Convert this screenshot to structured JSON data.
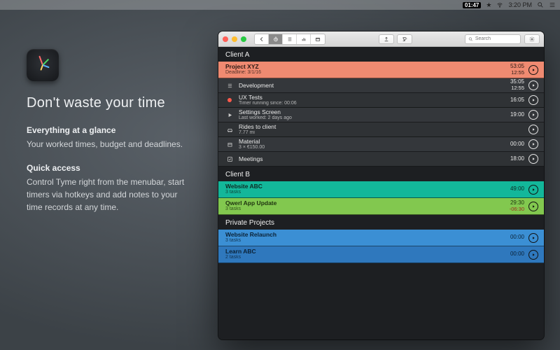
{
  "menubar": {
    "date_badge": "01:47",
    "time": "3:20 PM",
    "wifi_icon": "wifi",
    "list_icon": "list"
  },
  "marketing": {
    "headline": "Don't waste your time",
    "sec1_title": "Everything at a glance",
    "sec1_body": "Your worked times, budget and deadlines.",
    "sec2_title": "Quick access",
    "sec2_body": "Control Tyme right from the menubar, start timers via hotkeys and add notes to your time records at any time."
  },
  "toolbar": {
    "search_placeholder": "Search"
  },
  "groups": [
    {
      "name": "Client A",
      "projects": [
        {
          "color": "salmon",
          "title": "Project XYZ",
          "subtitle": "Deadline: 3/1/16",
          "time_top": "53:05",
          "time_bottom": "12:55",
          "tasks": [
            {
              "icon": "list",
              "title": "Development",
              "sub": "",
              "time_top": "35:05",
              "time_bottom": "12:55",
              "alt": false
            },
            {
              "icon": "rec",
              "title": "UX Tests",
              "sub": "Timer running since: 00:06",
              "time_top": "16:05",
              "time_bottom": "",
              "alt": true
            },
            {
              "icon": "play",
              "title": "Settings Screen",
              "sub": "Last worked: 2 days ago",
              "time_top": "19:00",
              "time_bottom": "",
              "alt": false
            },
            {
              "icon": "car",
              "title": "Rides to client",
              "sub": "7.77 mi",
              "time_top": "",
              "time_bottom": "",
              "alt": true
            },
            {
              "icon": "box",
              "title": "Material",
              "sub": "3 × €150.00",
              "time_top": "00:00",
              "time_bottom": "",
              "alt": false
            },
            {
              "icon": "check",
              "title": "Meetings",
              "sub": "",
              "time_top": "18:00",
              "time_bottom": "",
              "alt": true
            }
          ]
        }
      ]
    },
    {
      "name": "Client B",
      "projects": [
        {
          "color": "teal",
          "title": "Website ABC",
          "subtitle": "3 tasks",
          "time_top": "49:00",
          "time_bottom": "",
          "tasks": []
        },
        {
          "color": "green",
          "title": "Qwerl App Update",
          "subtitle": "3 tasks",
          "time_top": "29:30",
          "time_bottom": "-06:30",
          "neg": true,
          "tasks": []
        }
      ]
    },
    {
      "name": "Private Projects",
      "projects": [
        {
          "color": "blue",
          "title": "Website Relaunch",
          "subtitle": "3 tasks",
          "time_top": "00:00",
          "time_bottom": "",
          "tasks": []
        },
        {
          "color": "blue2",
          "title": "Learn ABC",
          "subtitle": "2 tasks",
          "time_top": "00:00",
          "time_bottom": "",
          "tasks": []
        }
      ]
    }
  ]
}
